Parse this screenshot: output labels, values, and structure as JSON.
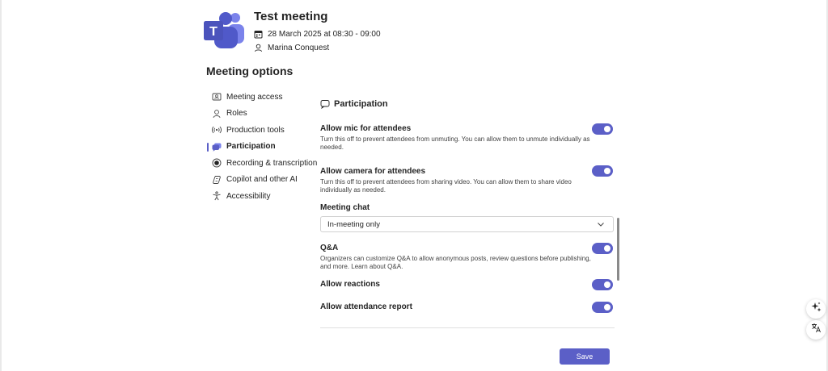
{
  "meeting": {
    "title": "Test meeting",
    "datetime": "28 March 2025 at 08:30 - 09:00",
    "organizer": "Marina Conquest"
  },
  "section_heading": "Meeting options",
  "nav": {
    "items": [
      {
        "label": "Meeting access",
        "icon": "meeting-access-icon"
      },
      {
        "label": "Roles",
        "icon": "person-icon"
      },
      {
        "label": "Production tools",
        "icon": "broadcast-icon"
      },
      {
        "label": "Participation",
        "icon": "chat-bubbles-icon",
        "active": true
      },
      {
        "label": "Recording & transcription",
        "icon": "record-icon"
      },
      {
        "label": "Copilot and other AI",
        "icon": "copilot-icon"
      },
      {
        "label": "Accessibility",
        "icon": "accessibility-icon"
      }
    ]
  },
  "panel": {
    "title": "Participation",
    "options": {
      "mic": {
        "label": "Allow mic for attendees",
        "description": "Turn this off to prevent attendees from unmuting. You can allow them to unmute individually as needed.",
        "enabled": true
      },
      "camera": {
        "label": "Allow camera for attendees",
        "description": "Turn this off to prevent attendees from sharing video. You can allow them to share video individually as needed.",
        "enabled": true
      },
      "chat": {
        "label": "Meeting chat",
        "selected": "In-meeting only"
      },
      "qa": {
        "label": "Q&A",
        "description": "Organizers can customize Q&A to allow anonymous posts, review questions before publishing, and more. Learn about Q&A.",
        "enabled": true
      },
      "reactions": {
        "label": "Allow reactions",
        "enabled": true
      },
      "attendance": {
        "label": "Allow attendance report",
        "enabled": true
      }
    }
  },
  "actions": {
    "save_label": "Save"
  },
  "floating": {
    "sparkle_icon": "sparkle-icon",
    "translate_icon": "translate-icon"
  },
  "colors": {
    "accent": "#5b5fc7",
    "text": "#242424",
    "logo_dark": "#4b53bc",
    "logo_light": "#7b83eb"
  }
}
